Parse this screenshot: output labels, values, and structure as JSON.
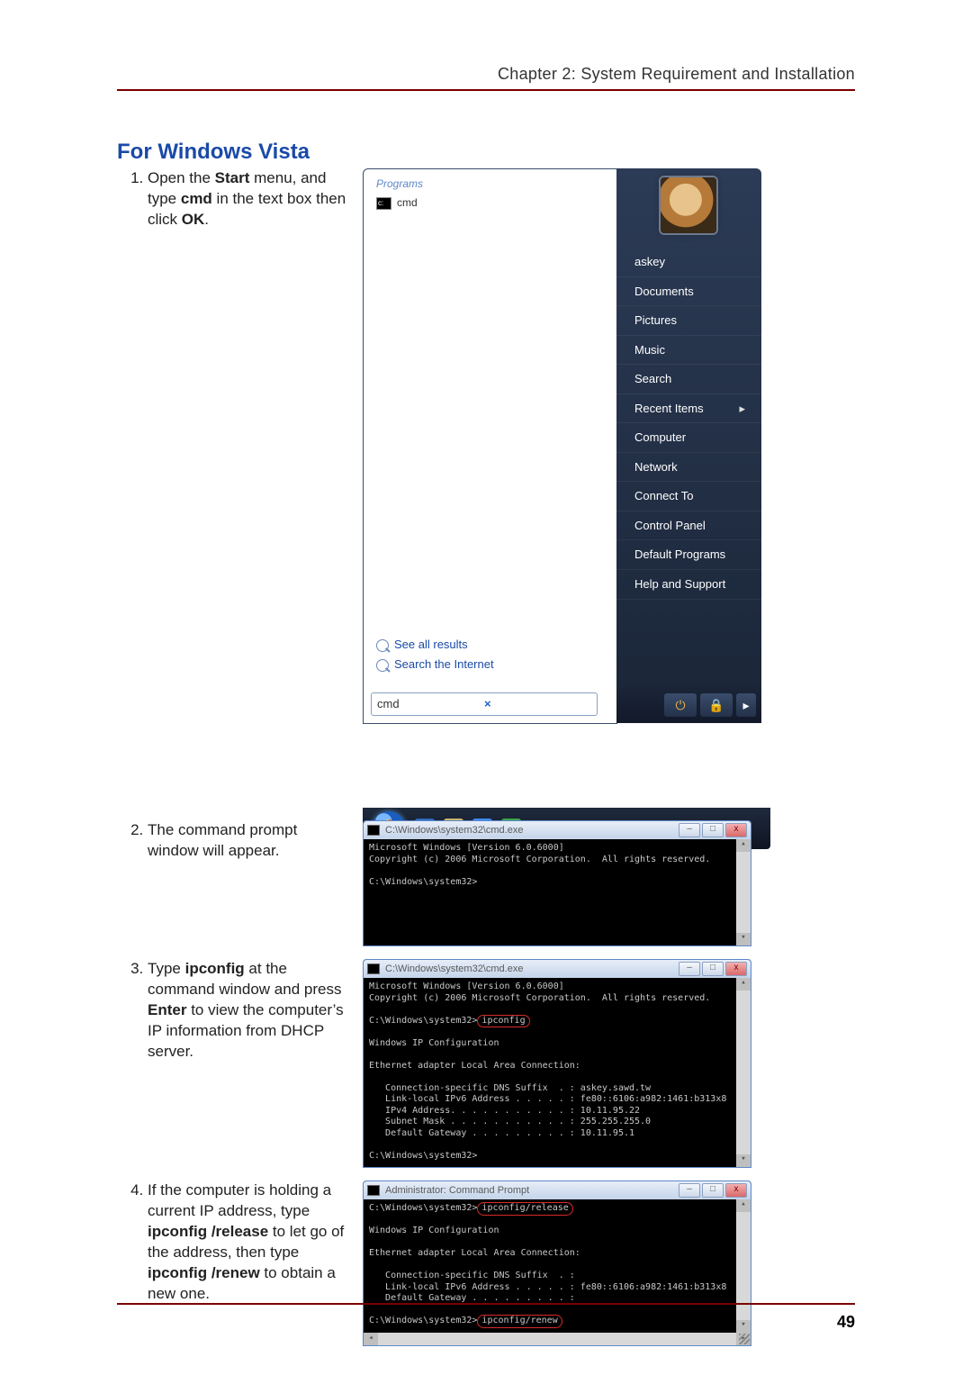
{
  "header": {
    "running": "Chapter 2: System Requirement and Installation"
  },
  "page_number": "49",
  "section_title": "For Windows Vista",
  "steps": {
    "s1": {
      "pre": "Open the ",
      "b1": "Start",
      "mid1": " menu, and type ",
      "b2": "cmd",
      "mid2": " in the text box then click ",
      "b3": "OK",
      "post": "."
    },
    "s2": "The command prompt window will appear.",
    "s3": {
      "pre": "Type ",
      "b1": "ipconfig",
      "mid1": " at the command window and press ",
      "b2": "Enter",
      "post": " to view the computer’s IP information from DHCP server."
    },
    "s4": {
      "pre": "If the computer is holding a current IP address, type ",
      "b1": "ipconfig /release",
      "mid1": " to let go of the address, then type ",
      "b2": "ipconfig /renew",
      "post": " to obtain a new one."
    }
  },
  "vista": {
    "programs_header": "Programs",
    "cmd_label": "cmd",
    "see_all": "See all results",
    "see_net": "Search the Internet",
    "search_value": "cmd",
    "user": "askey",
    "menu": [
      "Documents",
      "Pictures",
      "Music",
      "Search",
      "Recent Items",
      "Computer",
      "Network",
      "Connect To",
      "Control Panel",
      "Default Programs",
      "Help and Support"
    ]
  },
  "cmd2": {
    "title": "C:\\Windows\\system32\\cmd.exe",
    "body": "Microsoft Windows [Version 6.0.6000]\nCopyright (c) 2006 Microsoft Corporation.  All rights reserved.\n\nC:\\Windows\\system32>"
  },
  "cmd3": {
    "title": "C:\\Windows\\system32\\cmd.exe",
    "l1": "Microsoft Windows [Version 6.0.6000]",
    "l2": "Copyright (c) 2006 Microsoft Corporation.  All rights reserved.",
    "prompt1_a": "C:\\Windows\\system32>",
    "prompt1_b": "ipconfig",
    "l3": "Windows IP Configuration",
    "l4": "Ethernet adapter Local Area Connection:",
    "l5": "   Connection-specific DNS Suffix  . : askey.sawd.tw",
    "l6": "   Link-local IPv6 Address . . . . . : fe80::6106:a982:1461:b313x8",
    "l7": "   IPv4 Address. . . . . . . . . . . : 10.11.95.22",
    "l8": "   Subnet Mask . . . . . . . . . . . : 255.255.255.0",
    "l9": "   Default Gateway . . . . . . . . . : 10.11.95.1",
    "prompt2": "C:\\Windows\\system32>"
  },
  "cmd4": {
    "title": "Administrator: Command Prompt",
    "prompt1_a": "C:\\Windows\\system32>",
    "prompt1_b": "ipconfig/release",
    "l2": "Windows IP Configuration",
    "l3": "Ethernet adapter Local Area Connection:",
    "l4": "   Connection-specific DNS Suffix  . :",
    "l5": "   Link-local IPv6 Address . . . . . : fe80::6106:a982:1461:b313x8",
    "l6": "   Default Gateway . . . . . . . . . :",
    "prompt2_a": "C:\\Windows\\system32>",
    "prompt2_b": "ipconfig/renew"
  }
}
